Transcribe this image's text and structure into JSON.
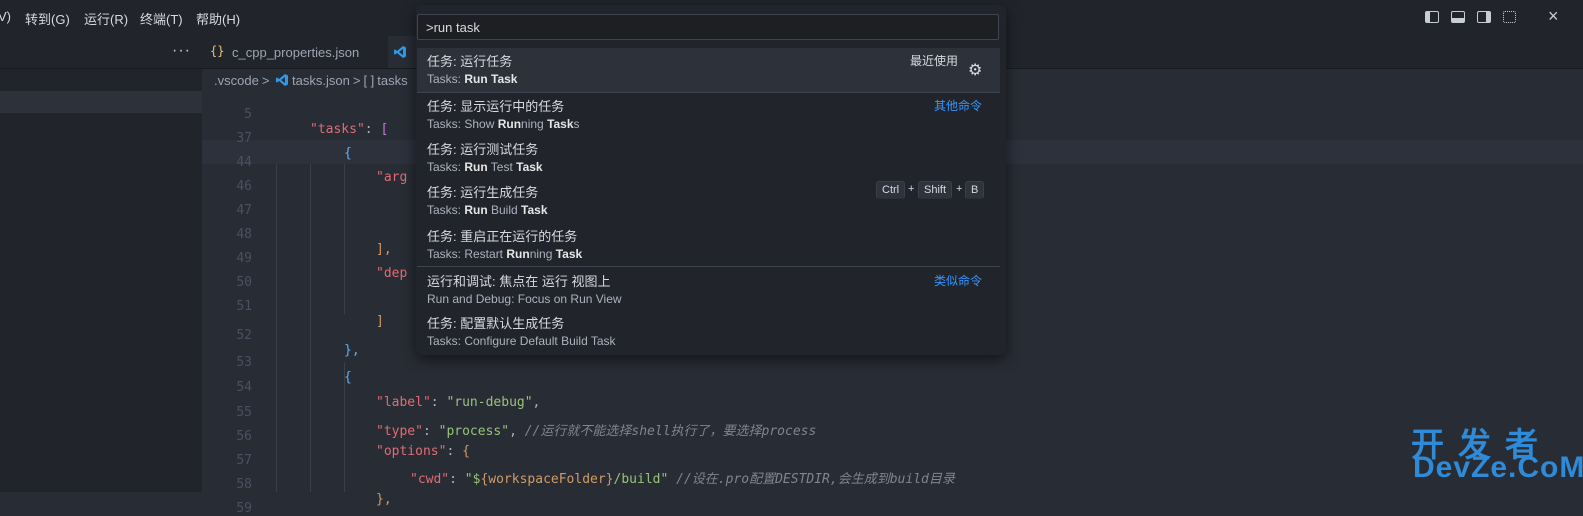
{
  "menubar": {
    "items": [
      "V)",
      "转到(G)",
      "运行(R)",
      "终端(T)",
      "帮助(H)"
    ],
    "layout_icons": [
      "toggle-primary-sidebar-icon",
      "toggle-panel-icon",
      "toggle-secondary-sidebar-icon",
      "customize-layout-icon"
    ],
    "close_label": "×"
  },
  "tabs": {
    "more_label": "···",
    "tab1": {
      "icon": "{}",
      "label": "c_cpp_properties.json"
    }
  },
  "breadcrumb": {
    "folder": ".vscode",
    "sep": ">",
    "file": "tasks.json",
    "symbol_icon": "[ ]",
    "symbol": "tasks"
  },
  "editor": {
    "lines": [
      {
        "n": "5"
      },
      {
        "n": "37"
      },
      {
        "n": "44"
      },
      {
        "n": "46"
      },
      {
        "n": "47"
      },
      {
        "n": "48"
      },
      {
        "n": "49"
      },
      {
        "n": "50"
      },
      {
        "n": "51"
      },
      {
        "n": "52"
      },
      {
        "n": "53"
      },
      {
        "n": "54"
      },
      {
        "n": "55"
      },
      {
        "n": "56"
      },
      {
        "n": "57"
      },
      {
        "n": "58"
      },
      {
        "n": "59"
      }
    ],
    "tokens": {
      "tasks_key": "\"tasks\"",
      "colon": ": ",
      "lbracket": "[",
      "lbrace": "{",
      "arg_key": "\"arg",
      "rbracket_comma": "],",
      "dep_key": "\"dep",
      "rbracket": "]",
      "rbrace_comma": "},",
      "label_key": "\"label\"",
      "label_val": "\"run-debug\"",
      "comma": ",",
      "type_key": "\"type\"",
      "type_val": "\"process\"",
      "type_comment": "//运行就不能选择shell执行了，要选择process",
      "options_key": "\"options\"",
      "cwd_key": "\"cwd\"",
      "cwd_val_pre": "\"$",
      "cwd_var": "{workspaceFolder}",
      "cwd_val_post": "/build\"",
      "cwd_comment": "//设在.pro配置DESTDIR,会生成到build目录"
    }
  },
  "palette": {
    "input_value": ">run task",
    "items": [
      {
        "label": "任务: 运行任务",
        "detail": [
          "Tasks: ",
          "Run",
          " ",
          "Task"
        ],
        "group": "最近使用"
      },
      {
        "label": "任务: 显示运行中的任务",
        "detail": [
          "Tasks: Show ",
          "Run",
          "ning ",
          "Task",
          "s"
        ],
        "group": "其他命令"
      },
      {
        "label": "任务: 运行测试任务",
        "detail": [
          "Tasks: ",
          "Run",
          " Test ",
          "Task"
        ]
      },
      {
        "label": "任务: 运行生成任务",
        "detail": [
          "Tasks: ",
          "Run",
          " Build ",
          "Task"
        ],
        "keys": [
          "Ctrl",
          "Shift",
          "B"
        ],
        "plus": "+"
      },
      {
        "label": "任务: 重启正在运行的任务",
        "detail": [
          "Tasks: Restart ",
          "Run",
          "ning ",
          "Task"
        ]
      },
      {
        "label": "运行和调试: 焦点在 运行 视图上",
        "detail": [
          "Run and Debug: Focus on Run View"
        ],
        "group": "类似命令"
      },
      {
        "label": "任务: 配置默认生成任务",
        "detail": [
          "Tasks: Configure Default Build Task"
        ]
      }
    ],
    "gear_icon": "⚙"
  },
  "watermark": {
    "cn": "开发者",
    "en": "DevZe.CoM"
  }
}
